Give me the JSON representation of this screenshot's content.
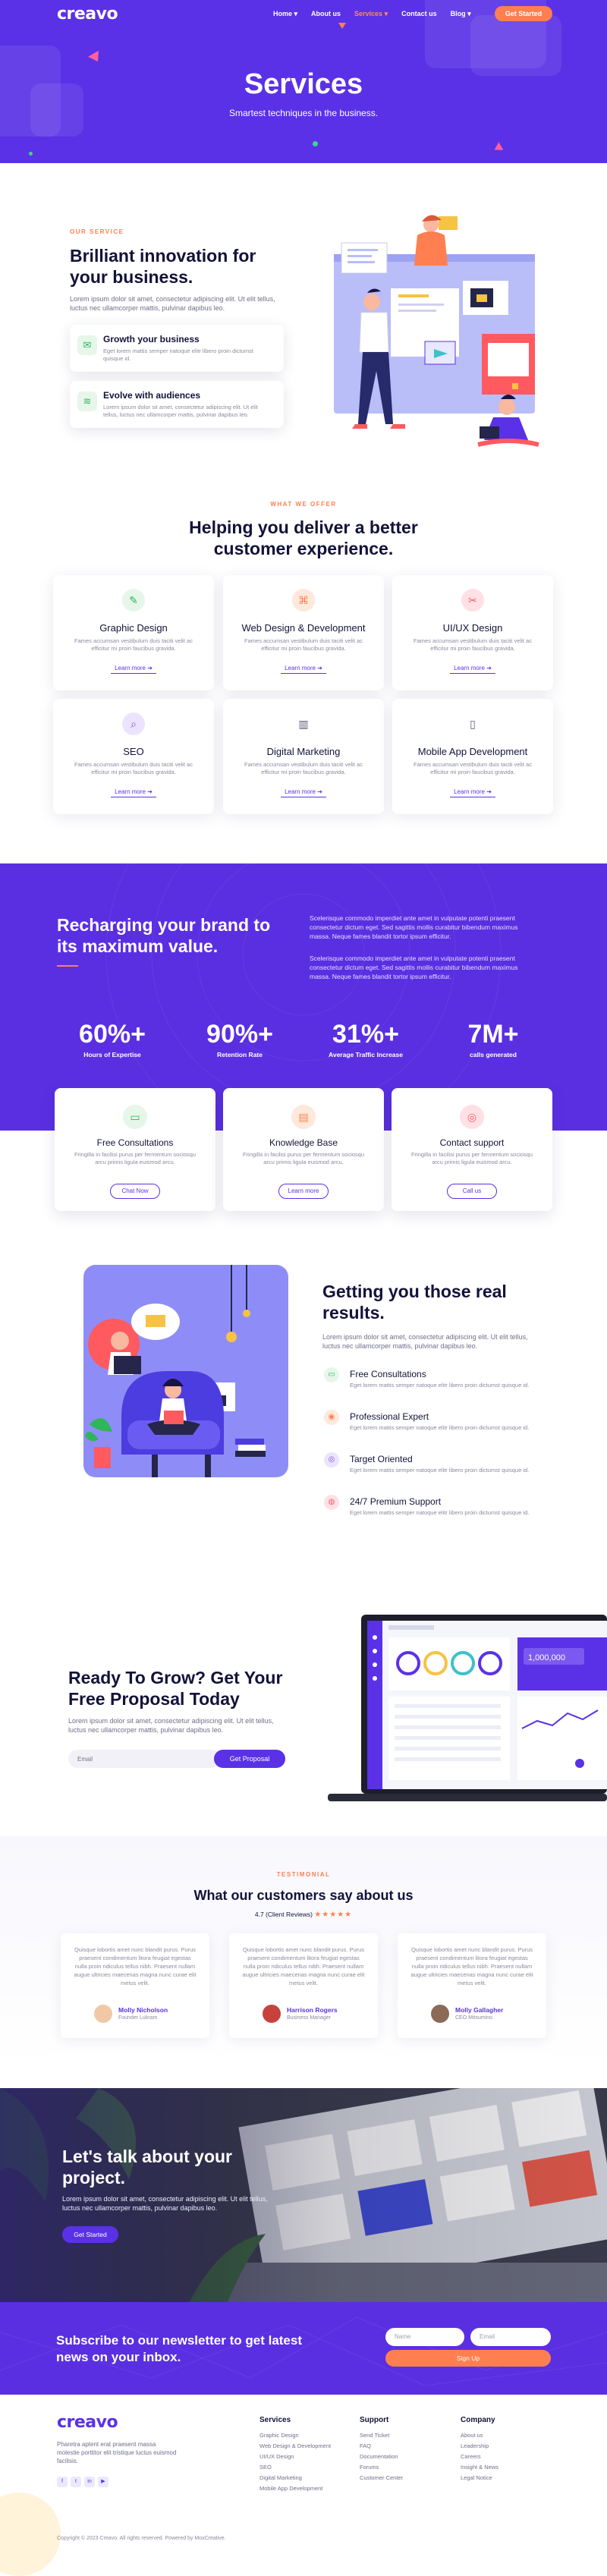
{
  "nav": {
    "logo": "creavo",
    "links": [
      "Home ▾",
      "About us",
      "Services ▾",
      "Contact us",
      "Blog ▾"
    ],
    "cta": "Get Started"
  },
  "hero": {
    "title": "Services",
    "subtitle": "Smartest techniques in the business."
  },
  "intro": {
    "eyebrow": "OUR SERVICE",
    "title": "Brilliant innovation for your business.",
    "text": "Lorem ipsum dolor sit amet, consectetur adipiscing elit. Ut elit tellus, luctus nec ullamcorper mattis, pulvinar dapibus leo.",
    "features": [
      {
        "title": "Growth your business",
        "text": "Eget lorem mattis semper natoque elitr libero proin dictumst quisque id."
      },
      {
        "title": "Evolve with audiences",
        "text": "Lorem ipsum dolor sit amet, consectetur adipiscing elit. Ut elit tellus, luctus nec ullamcorper mattis, pulvinar dapibus leo."
      }
    ]
  },
  "offer": {
    "eyebrow": "WHAT WE OFFER",
    "title": "Helping you deliver a better customer experience.",
    "learn_more": "Learn more ➔",
    "cards": [
      {
        "title": "Graphic Design",
        "text": "Fames accumsan vestibulum duis taciti velit ac efficitur mi proin faucibus gravida."
      },
      {
        "title": "Web Design & Development",
        "text": "Fames accumsan vestibulum duis taciti velit ac efficitur mi proin faucibus gravida."
      },
      {
        "title": "UI/UX Design",
        "text": "Fames accumsan vestibulum duis taciti velit ac efficitur mi proin faucibus gravida."
      },
      {
        "title": "SEO",
        "text": "Fames accumsan vestibulum duis taciti velit ac efficitur mi proin faucibus gravida."
      },
      {
        "title": "Digital Marketing",
        "text": "Fames accumsan vestibulum duis taciti velit ac efficitur mi proin faucibus gravida."
      },
      {
        "title": "Mobile App Development",
        "text": "Fames accumsan vestibulum duis taciti velit ac efficitur mi proin faucibus gravida."
      }
    ]
  },
  "brand": {
    "title": "Recharging your brand to its maximum value.",
    "p1": "Scelerisque commodo imperdiet ante amet in vulputate potenti praesent consectetur dictum eget. Sed sagittis mollis curabitur bibendum maximus massa. Neque fames blandit tortor ipsum efficitur.",
    "p2": "Scelerisque commodo imperdiet ante amet in vulputate potenti praesent consectetur dictum eget. Sed sagittis mollis curabitur bibendum maximus massa. Neque fames blandit tortor ipsum efficitur.",
    "stats": [
      {
        "value": "60%+",
        "label": "Hours of Expertise"
      },
      {
        "value": "90%+",
        "label": "Retention Rate"
      },
      {
        "value": "31%+",
        "label": "Average Traffic Increase"
      },
      {
        "value": "7M+",
        "label": "calls generated"
      }
    ],
    "support": [
      {
        "title": "Free Consultations",
        "text": "Fringilla in facilisi purus per fermentum sociosqu arcu primis ligula euismod arcu.",
        "button": "Chat Now"
      },
      {
        "title": "Knowledge Base",
        "text": "Fringilla in facilisi purus per fermentum sociosqu arcu primis ligula euismod arcu.",
        "button": "Learn more"
      },
      {
        "title": "Contact support",
        "text": "Fringilla in facilisi purus per fermentum sociosqu arcu primis ligula euismod arcu.",
        "button": "Call us"
      }
    ]
  },
  "results": {
    "title": "Getting you those real results.",
    "text": "Lorem ipsum dolor sit amet, consectetur adipiscing elit. Ut elit tellus, luctus nec ullamcorper mattis, pulvinar dapibus leo.",
    "items": [
      {
        "title": "Free Consultations",
        "text": "Eget lorem mattis semper natoque elitr libero proin dictumst quisque id."
      },
      {
        "title": "Professional Expert",
        "text": "Eget lorem mattis semper natoque elitr libero proin dictumst quisque id."
      },
      {
        "title": "Target Oriented",
        "text": "Eget lorem mattis semper natoque elitr libero proin dictumst quisque id."
      },
      {
        "title": "24/7 Premium Support",
        "text": "Eget lorem mattis semper natoque elitr libero proin dictumst quisque id."
      }
    ]
  },
  "proposal": {
    "title": "Ready To Grow? Get Your Free Proposal Today",
    "text": "Lorem ipsum dolor sit amet, consectetur adipiscing elit. Ut elit tellus, luctus nec ullamcorper mattis, pulvinar dapibus leo.",
    "placeholder": "Email",
    "button": "Get Proposal",
    "dashboard_value": "1,000,000"
  },
  "testimonials": {
    "eyebrow": "TESTIMONIAL",
    "title": "What our customers say about us",
    "rating": "4.7 (Client Reviews)",
    "stars": "★★★★★",
    "items": [
      {
        "quote": "Quisque lobortis amet nunc blandit purus. Purus praesent condimentum litora feugiat egestas nulla proin ridiculus tellus nibh. Praesent nullam augue ultricies maecenas magna nunc curae elit metus velit.",
        "name": "Molly Nicholson",
        "role": "Founder Lukram"
      },
      {
        "quote": "Quisque lobortis amet nunc blandit purus. Purus praesent condimentum litora feugiat egestas nulla proin ridiculus tellus nibh. Praesent nullam augue ultricies maecenas magna nunc curae elit metus velit.",
        "name": "Harrison Rogers",
        "role": "Business Manager"
      },
      {
        "quote": "Quisque lobortis amet nunc blandit purus. Purus praesent condimentum litora feugiat egestas nulla proin ridiculus tellus nibh. Praesent nullam augue ultricies maecenas magna nunc curae elit metus velit.",
        "name": "Molly Gallagher",
        "role": "CEO Mitsumino"
      }
    ]
  },
  "talk": {
    "title": "Let's talk about your project.",
    "text": "Lorem ipsum dolor sit amet, consectetur adipiscing elit. Ut elit tellus, luctus nec ullamcorper mattis, pulvinar dapibus leo.",
    "button": "Get Started"
  },
  "newsletter": {
    "title": "Subscribe to our newsletter to get latest news on your inbox.",
    "name_placeholder": "Name",
    "email_placeholder": "Email",
    "button": "Sign Up"
  },
  "footer": {
    "logo": "creavo",
    "about": "Pharetra aptent erat praesent massa molestie porttitor elit tristique luctus euismod facilisis.",
    "social": [
      "f",
      "t",
      "in",
      "▶"
    ],
    "columns": [
      {
        "heading": "Services",
        "items": [
          "Graphic Design",
          "Web Design & Development",
          "UI/UX Design",
          "SEO",
          "Digital Marketing",
          "Mobile App Development"
        ]
      },
      {
        "heading": "Support",
        "items": [
          "Send Ticket",
          "FAQ",
          "Documentation",
          "Forums",
          "Customer Center"
        ]
      },
      {
        "heading": "Company",
        "items": [
          "About us",
          "Leadership",
          "Careers",
          "Insight & News",
          "Legal Notice"
        ]
      }
    ],
    "copyright": "Copyright © 2023 Creavo. All rights reserved. Powered by MoxCreative."
  },
  "colors": {
    "brand": "#5a31e6",
    "accent": "#ff7f50",
    "dark": "#12123a"
  }
}
